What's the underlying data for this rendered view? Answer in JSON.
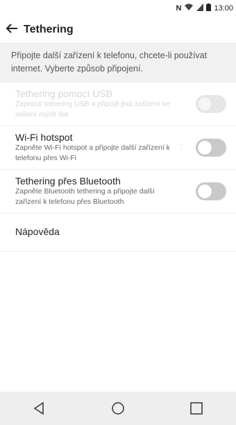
{
  "status": {
    "nfc": "N",
    "time": "13:00"
  },
  "header": {
    "title": "Tethering"
  },
  "intro": "Připojte další zařízení k telefonu, chcete-li používat internet. Vyberte způsob připojení.",
  "rows": [
    {
      "title": "Tethering pomocí USB",
      "subtitle": "Zapnout tethering USB a připojit jiná zařízení ke sdílení mých dat",
      "enabled": false,
      "on": false
    },
    {
      "title": "Wi-Fi hotspot",
      "subtitle": "Zapněte Wi-Fi hotspot a připojte další zařízení k telefonu přes Wi-Fi",
      "enabled": true,
      "on": false
    },
    {
      "title": "Tethering přes Bluetooth",
      "subtitle": "Zapněte Bluetooth tethering a připojte další zařízení k telefonu přes Bluetooth",
      "enabled": true,
      "on": false
    }
  ],
  "help_label": "Nápověda",
  "navbar": {
    "icons": [
      "back-icon",
      "home-icon",
      "recents-icon"
    ]
  }
}
